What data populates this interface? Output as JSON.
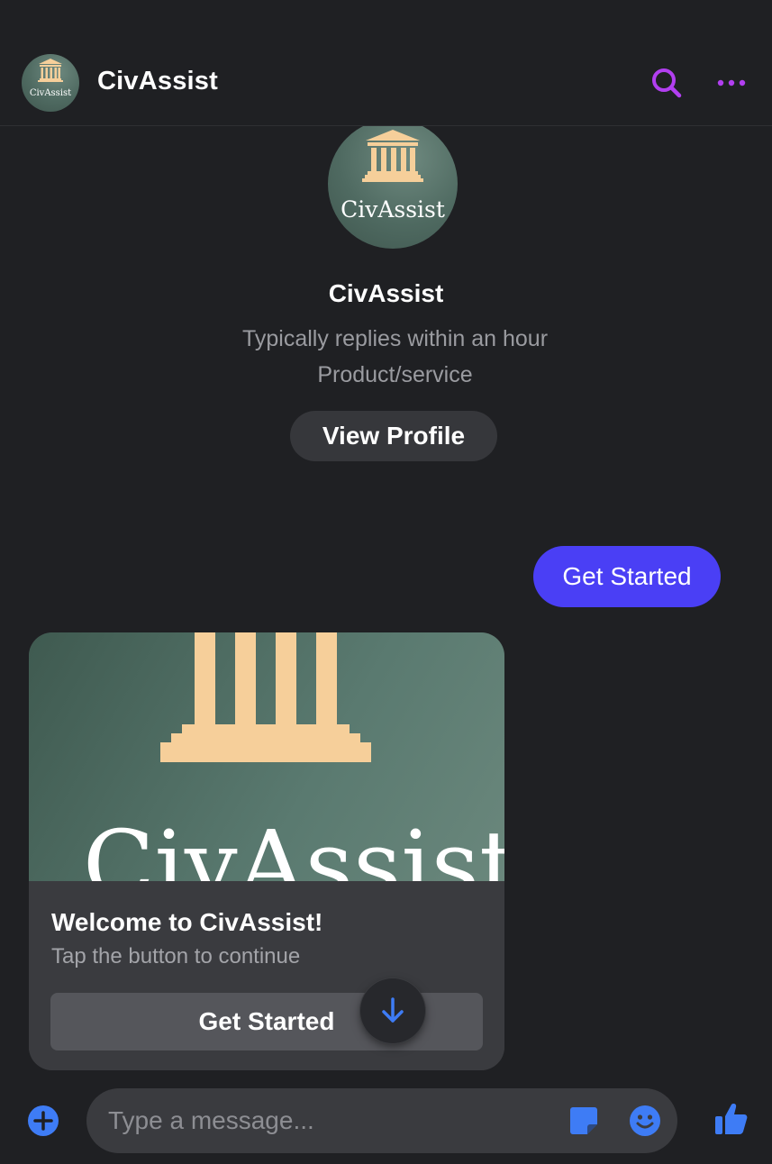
{
  "colors": {
    "accent_purple": "#b23ff0",
    "messenger_blue": "#3e7cf5",
    "outgoing_bubble": "#4a3ff5",
    "logo_gold": "#f6cf9a",
    "logo_green": "#4f6a61"
  },
  "header": {
    "title": "CivAssist",
    "avatar_logo_text": "CivAssist",
    "icons": [
      "search-icon",
      "more-options-icon"
    ]
  },
  "profile": {
    "logo_text": "CivAssist",
    "name": "CivAssist",
    "response_time": "Typically replies within an hour",
    "category": "Product/service",
    "view_profile_label": "View Profile"
  },
  "messages": {
    "outgoing_text": "Get Started",
    "card": {
      "image_text": "CivAssist",
      "title": "Welcome to CivAssist!",
      "subtitle": "Tap the button to continue",
      "button_label": "Get Started"
    }
  },
  "composer": {
    "placeholder": "Type a message...",
    "icons": [
      "plus-icon",
      "sticker-icon",
      "emoji-icon",
      "thumbs-up-icon"
    ]
  },
  "scroll_down_icon": "arrow-down-icon"
}
